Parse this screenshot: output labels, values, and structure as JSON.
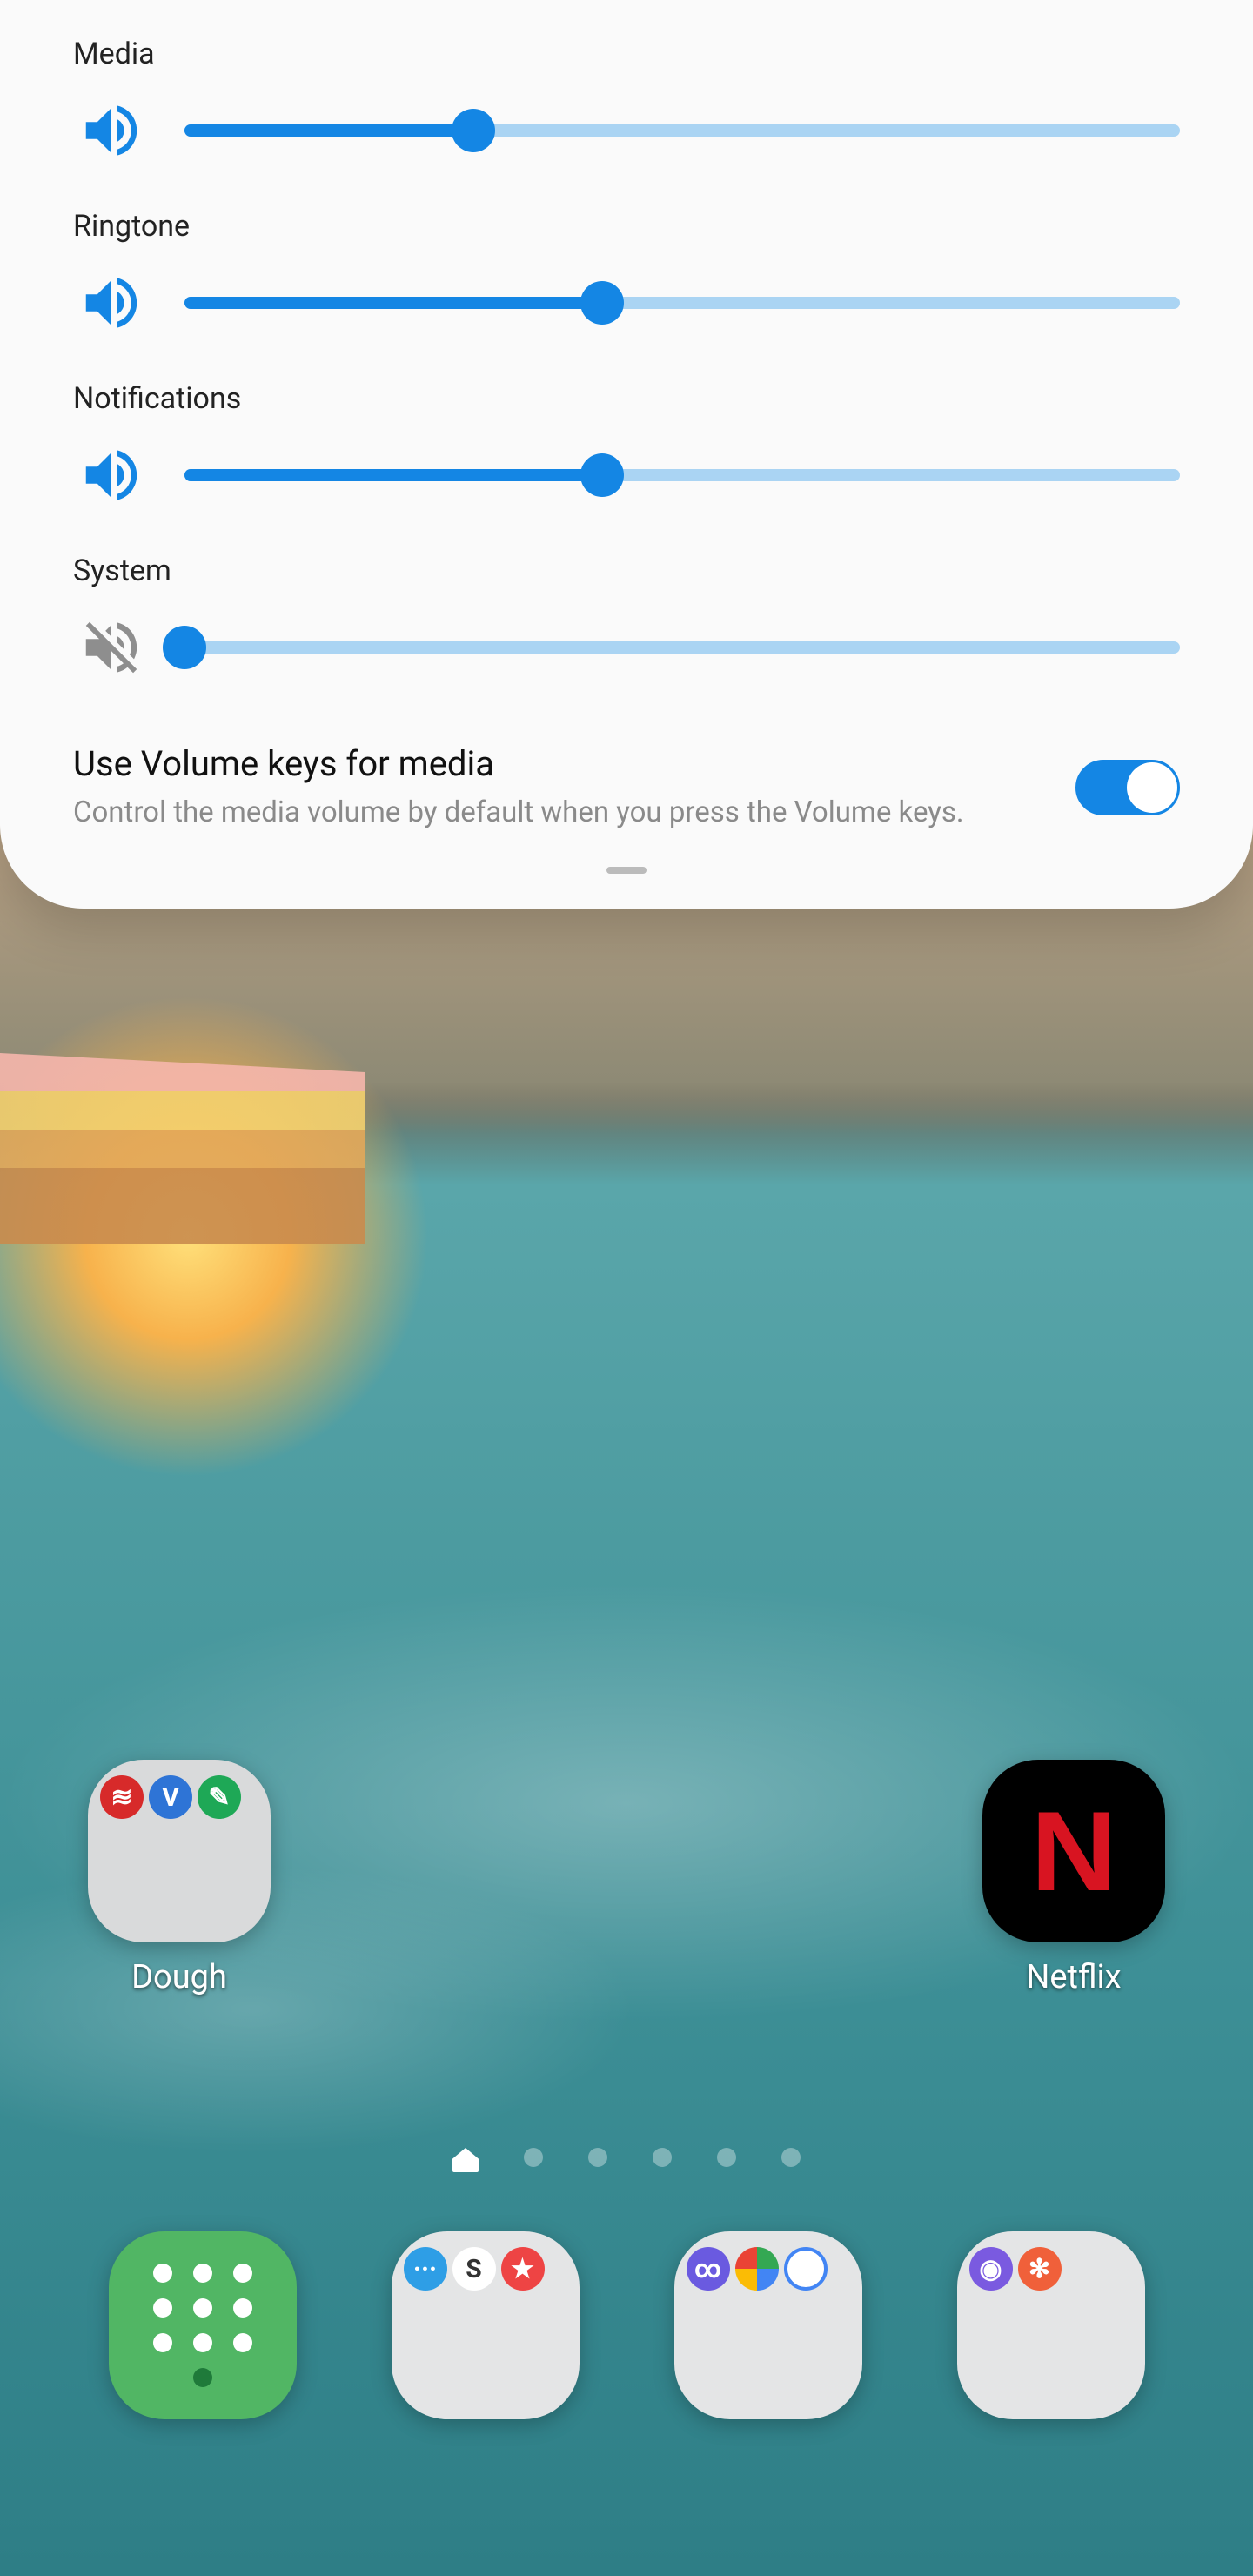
{
  "panel": {
    "sliders": [
      {
        "key": "media",
        "label": "Media",
        "percent": 29,
        "muted": false
      },
      {
        "key": "ringtone",
        "label": "Ringtone",
        "percent": 42,
        "muted": false
      },
      {
        "key": "notifications",
        "label": "Notifications",
        "percent": 42,
        "muted": false
      },
      {
        "key": "system",
        "label": "System",
        "percent": 0,
        "muted": true
      }
    ],
    "volume_keys_media": {
      "title": "Use Volume keys for media",
      "subtitle": "Control the media volume by default when you press the Volume keys.",
      "enabled": true
    }
  },
  "home": {
    "apps": {
      "dough": {
        "label": "Dough"
      },
      "netflix": {
        "label": "Netflix"
      }
    },
    "page_indicator": {
      "count": 6,
      "current": 0
    },
    "colors": {
      "accent": "#1486e4",
      "track": "#aad4f3",
      "phone_tile": "#51b664",
      "netflix_red": "#d81421"
    }
  }
}
